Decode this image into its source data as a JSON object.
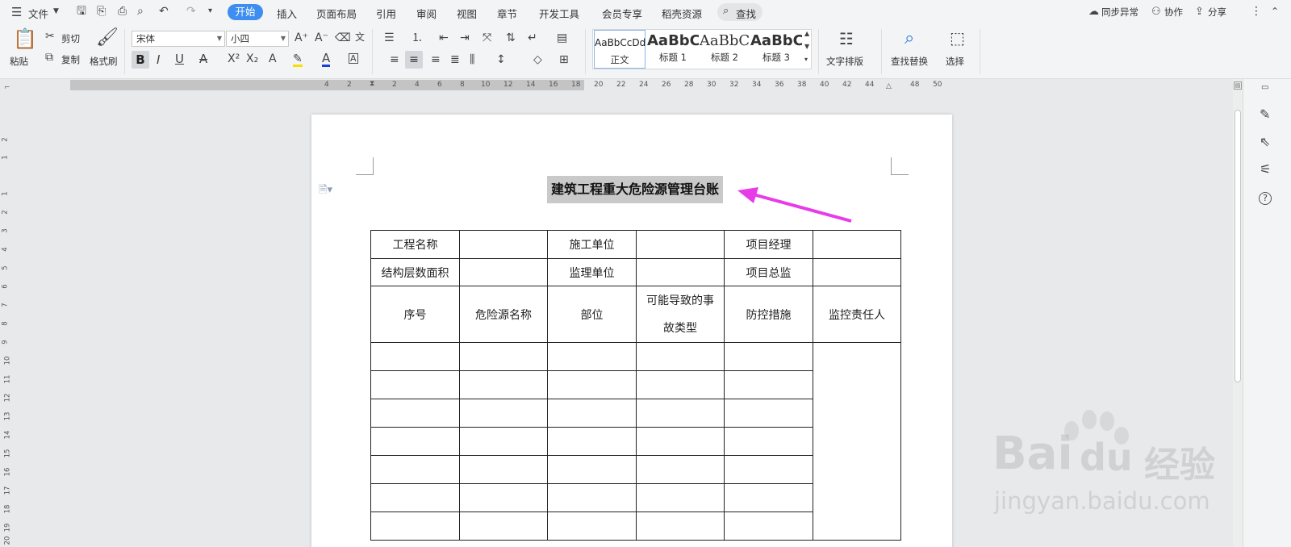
{
  "menubar": {
    "file_label": "文件",
    "tabs": [
      "开始",
      "插入",
      "页面布局",
      "引用",
      "审阅",
      "视图",
      "章节",
      "开发工具",
      "会员专享",
      "稻壳资源"
    ],
    "active_tab": "开始",
    "search_label": "查找",
    "right": {
      "sync": "同步异常",
      "collab": "协作",
      "share": "分享"
    }
  },
  "ribbon": {
    "paste": "粘贴",
    "cut": "剪切",
    "copy": "复制",
    "format_painter": "格式刷",
    "font_name": "宋体",
    "font_size": "小四",
    "styles": [
      {
        "sample": "AaBbCcDd",
        "name": "正文"
      },
      {
        "sample": "AaBbC",
        "name": "标题 1"
      },
      {
        "sample": "AaBbC",
        "name": "标题 2"
      },
      {
        "sample": "AaBbC",
        "name": "标题 3"
      }
    ],
    "text_layout": "文字排版",
    "find_replace": "查找替换",
    "select": "选择"
  },
  "ruler": {
    "h_labels": [
      "4",
      "2",
      "2",
      "4",
      "6",
      "8",
      "10",
      "12",
      "14",
      "16",
      "18",
      "20",
      "22",
      "24",
      "26",
      "28",
      "30",
      "32",
      "34",
      "36",
      "38",
      "40",
      "42",
      "44",
      "48",
      "50"
    ],
    "v_labels": [
      "2",
      "1",
      "1",
      "2",
      "3",
      "4",
      "5",
      "6",
      "7",
      "8",
      "9",
      "10",
      "11",
      "12",
      "13",
      "14",
      "15",
      "16",
      "17",
      "18",
      "19",
      "20"
    ]
  },
  "document": {
    "title": "建筑工程重大危险源管理台账",
    "table": {
      "row1": [
        "工程名称",
        "",
        "施工单位",
        "",
        "项目经理",
        ""
      ],
      "row2": [
        "结构层数面积",
        "",
        "监理单位",
        "",
        "项目总监",
        ""
      ],
      "header": [
        "序号",
        "危险源名称",
        "部位",
        "可能导致的事故类型",
        "防控措施",
        "监控责任人"
      ],
      "empty_rows": 7
    }
  },
  "watermark": {
    "brand": "Bai",
    "brand2": "du",
    "jingyan": "经验",
    "url": "jingyan.baidu.com"
  },
  "colors": {
    "accent": "#3d8ef0",
    "arrow": "#e73ce8"
  }
}
